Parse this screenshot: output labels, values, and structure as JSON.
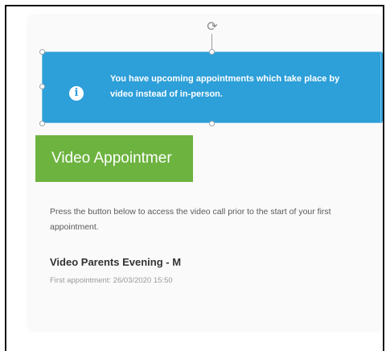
{
  "banner": {
    "icon": "info-icon",
    "message": "You have upcoming appointments which take place by video instead of in-person.",
    "color": "#2d9fd9"
  },
  "section": {
    "heading": "Video Appointmer",
    "heading_color": "#6db33f",
    "description": "Press the button below to access the video call prior to the start of your first appointment."
  },
  "meeting": {
    "title": "Video Parents Evening - M",
    "first_appointment": "First appointment: 26/03/2020 15:50"
  }
}
